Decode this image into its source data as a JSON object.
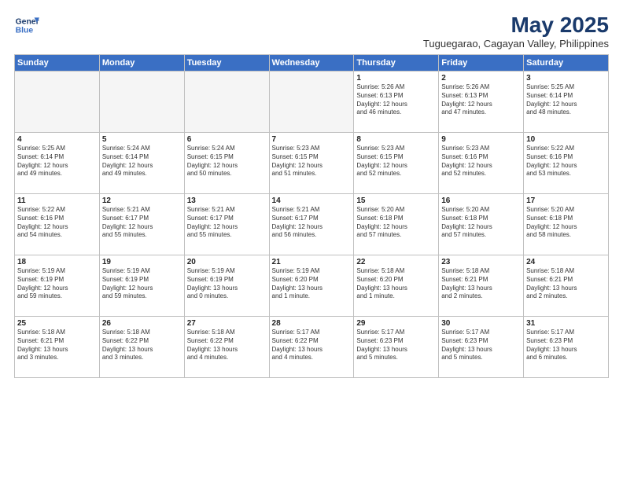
{
  "logo": {
    "line1": "General",
    "line2": "Blue"
  },
  "title": "May 2025",
  "subtitle": "Tuguegarao, Cagayan Valley, Philippines",
  "headers": [
    "Sunday",
    "Monday",
    "Tuesday",
    "Wednesday",
    "Thursday",
    "Friday",
    "Saturday"
  ],
  "weeks": [
    [
      {
        "day": "",
        "content": "",
        "empty": true
      },
      {
        "day": "",
        "content": "",
        "empty": true
      },
      {
        "day": "",
        "content": "",
        "empty": true
      },
      {
        "day": "",
        "content": "",
        "empty": true
      },
      {
        "day": "1",
        "content": "Sunrise: 5:26 AM\nSunset: 6:13 PM\nDaylight: 12 hours\nand 46 minutes."
      },
      {
        "day": "2",
        "content": "Sunrise: 5:26 AM\nSunset: 6:13 PM\nDaylight: 12 hours\nand 47 minutes."
      },
      {
        "day": "3",
        "content": "Sunrise: 5:25 AM\nSunset: 6:14 PM\nDaylight: 12 hours\nand 48 minutes."
      }
    ],
    [
      {
        "day": "4",
        "content": "Sunrise: 5:25 AM\nSunset: 6:14 PM\nDaylight: 12 hours\nand 49 minutes."
      },
      {
        "day": "5",
        "content": "Sunrise: 5:24 AM\nSunset: 6:14 PM\nDaylight: 12 hours\nand 49 minutes."
      },
      {
        "day": "6",
        "content": "Sunrise: 5:24 AM\nSunset: 6:15 PM\nDaylight: 12 hours\nand 50 minutes."
      },
      {
        "day": "7",
        "content": "Sunrise: 5:23 AM\nSunset: 6:15 PM\nDaylight: 12 hours\nand 51 minutes."
      },
      {
        "day": "8",
        "content": "Sunrise: 5:23 AM\nSunset: 6:15 PM\nDaylight: 12 hours\nand 52 minutes."
      },
      {
        "day": "9",
        "content": "Sunrise: 5:23 AM\nSunset: 6:16 PM\nDaylight: 12 hours\nand 52 minutes."
      },
      {
        "day": "10",
        "content": "Sunrise: 5:22 AM\nSunset: 6:16 PM\nDaylight: 12 hours\nand 53 minutes."
      }
    ],
    [
      {
        "day": "11",
        "content": "Sunrise: 5:22 AM\nSunset: 6:16 PM\nDaylight: 12 hours\nand 54 minutes."
      },
      {
        "day": "12",
        "content": "Sunrise: 5:21 AM\nSunset: 6:17 PM\nDaylight: 12 hours\nand 55 minutes."
      },
      {
        "day": "13",
        "content": "Sunrise: 5:21 AM\nSunset: 6:17 PM\nDaylight: 12 hours\nand 55 minutes."
      },
      {
        "day": "14",
        "content": "Sunrise: 5:21 AM\nSunset: 6:17 PM\nDaylight: 12 hours\nand 56 minutes."
      },
      {
        "day": "15",
        "content": "Sunrise: 5:20 AM\nSunset: 6:18 PM\nDaylight: 12 hours\nand 57 minutes."
      },
      {
        "day": "16",
        "content": "Sunrise: 5:20 AM\nSunset: 6:18 PM\nDaylight: 12 hours\nand 57 minutes."
      },
      {
        "day": "17",
        "content": "Sunrise: 5:20 AM\nSunset: 6:18 PM\nDaylight: 12 hours\nand 58 minutes."
      }
    ],
    [
      {
        "day": "18",
        "content": "Sunrise: 5:19 AM\nSunset: 6:19 PM\nDaylight: 12 hours\nand 59 minutes."
      },
      {
        "day": "19",
        "content": "Sunrise: 5:19 AM\nSunset: 6:19 PM\nDaylight: 12 hours\nand 59 minutes."
      },
      {
        "day": "20",
        "content": "Sunrise: 5:19 AM\nSunset: 6:19 PM\nDaylight: 13 hours\nand 0 minutes."
      },
      {
        "day": "21",
        "content": "Sunrise: 5:19 AM\nSunset: 6:20 PM\nDaylight: 13 hours\nand 1 minute."
      },
      {
        "day": "22",
        "content": "Sunrise: 5:18 AM\nSunset: 6:20 PM\nDaylight: 13 hours\nand 1 minute."
      },
      {
        "day": "23",
        "content": "Sunrise: 5:18 AM\nSunset: 6:21 PM\nDaylight: 13 hours\nand 2 minutes."
      },
      {
        "day": "24",
        "content": "Sunrise: 5:18 AM\nSunset: 6:21 PM\nDaylight: 13 hours\nand 2 minutes."
      }
    ],
    [
      {
        "day": "25",
        "content": "Sunrise: 5:18 AM\nSunset: 6:21 PM\nDaylight: 13 hours\nand 3 minutes."
      },
      {
        "day": "26",
        "content": "Sunrise: 5:18 AM\nSunset: 6:22 PM\nDaylight: 13 hours\nand 3 minutes."
      },
      {
        "day": "27",
        "content": "Sunrise: 5:18 AM\nSunset: 6:22 PM\nDaylight: 13 hours\nand 4 minutes."
      },
      {
        "day": "28",
        "content": "Sunrise: 5:17 AM\nSunset: 6:22 PM\nDaylight: 13 hours\nand 4 minutes."
      },
      {
        "day": "29",
        "content": "Sunrise: 5:17 AM\nSunset: 6:23 PM\nDaylight: 13 hours\nand 5 minutes."
      },
      {
        "day": "30",
        "content": "Sunrise: 5:17 AM\nSunset: 6:23 PM\nDaylight: 13 hours\nand 5 minutes."
      },
      {
        "day": "31",
        "content": "Sunrise: 5:17 AM\nSunset: 6:23 PM\nDaylight: 13 hours\nand 6 minutes."
      }
    ]
  ]
}
